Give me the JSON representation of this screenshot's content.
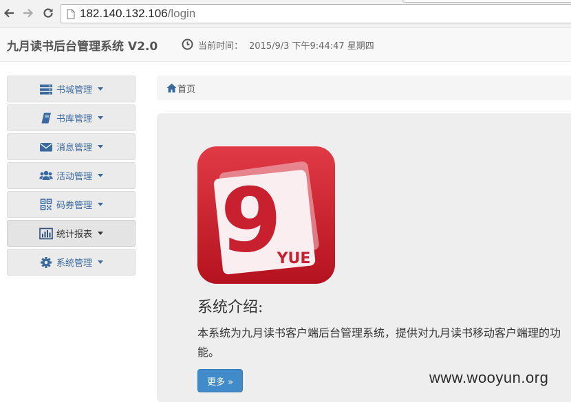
{
  "browser": {
    "url_host": "182.140.132.106",
    "url_path": "/login",
    "back_icon": "arrow-left-icon",
    "forward_icon": "arrow-right-icon",
    "reload_icon": "reload-icon"
  },
  "header": {
    "title": "九月读书后台管理系统 V2.0",
    "time_label": "当前时间：",
    "time_value": "2015/9/3 下午9:44:47 星期四",
    "clock_icon": "clock-icon"
  },
  "sidebar": {
    "items": [
      {
        "label": "书城管理",
        "icon": "server-icon"
      },
      {
        "label": "书库管理",
        "icon": "book-icon"
      },
      {
        "label": "消息管理",
        "icon": "envelope-icon"
      },
      {
        "label": "活动管理",
        "icon": "users-icon"
      },
      {
        "label": "码券管理",
        "icon": "qrcode-icon"
      },
      {
        "label": "统计报表",
        "icon": "bar-chart-icon"
      },
      {
        "label": "系统管理",
        "icon": "gear-icon"
      }
    ]
  },
  "breadcrumb": {
    "home_label": "首页"
  },
  "main": {
    "logo_text": "YUE",
    "logo_numeral": "9",
    "intro_title": "系统介绍:",
    "intro_text": "本系统为九月读书客户端后台管理系统，提供对九月读书移动客户端理的功能。",
    "more_label": "更多 »"
  },
  "watermark": "www.wooyun.org",
  "colors": {
    "accent_blue": "#428bca",
    "sidebar_text": "#3a6aa0",
    "logo_red": "#c8202f"
  }
}
